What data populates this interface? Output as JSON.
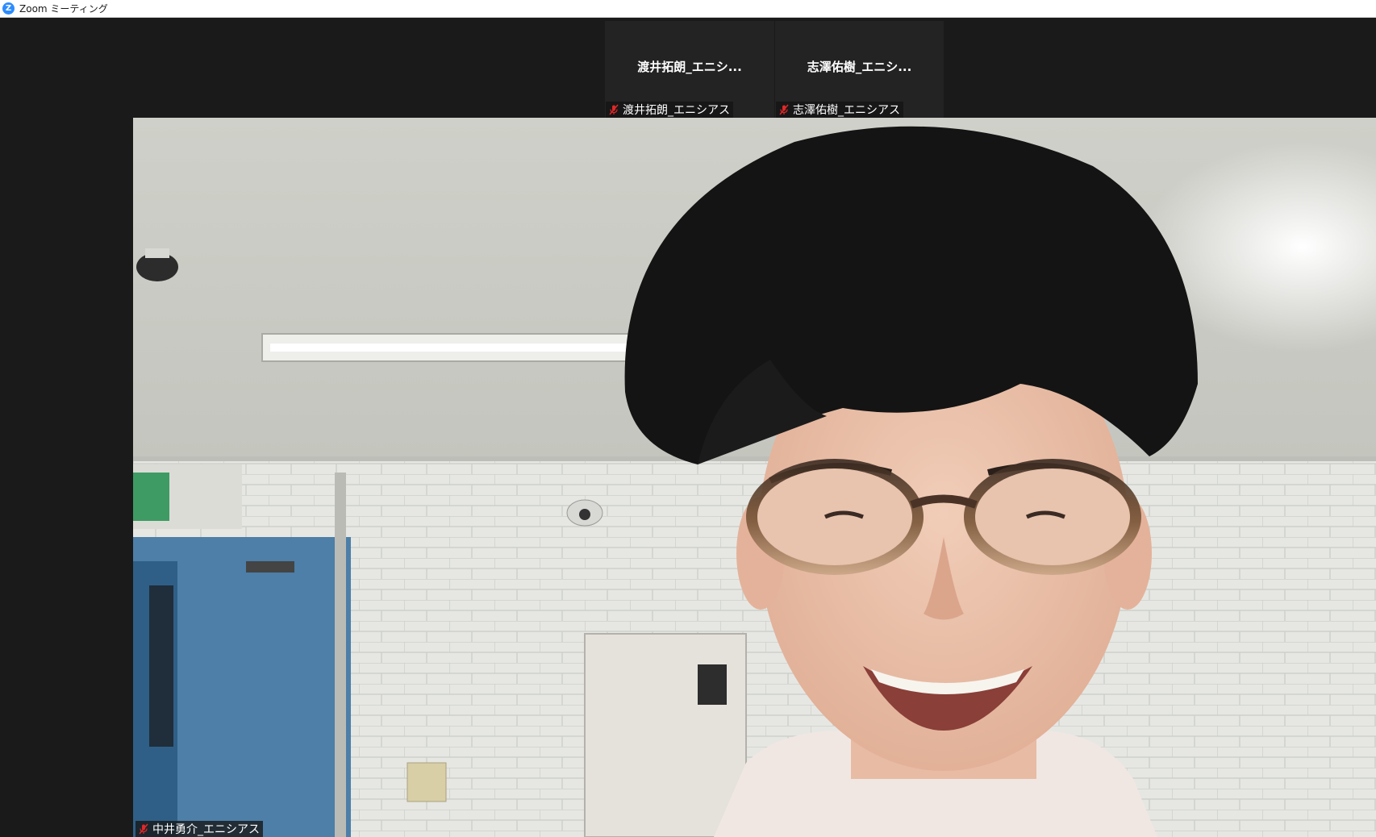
{
  "window": {
    "title": "Zoom ミーティング",
    "icon": "zoom-logo-icon",
    "icon_letter": "Z",
    "accent_color": "#2d8cff"
  },
  "thumbnails": [
    {
      "display_name": "渡井拓朗_エニシ...",
      "name_tag": "渡井拓朗_エニシアス",
      "mic_icon": "mic-muted-icon"
    },
    {
      "display_name": "志澤佑樹_エニシ...",
      "name_tag": "志澤佑樹_エニシアス",
      "mic_icon": "mic-muted-icon"
    }
  ],
  "main_video": {
    "name_tag": "中井勇介_エニシアス",
    "mic_icon": "mic-muted-icon",
    "content": "participant-camera-feed"
  },
  "colors": {
    "background": "#1a1a1a",
    "thumbnail_bg": "#232323",
    "muted_mic": "#e02828"
  }
}
